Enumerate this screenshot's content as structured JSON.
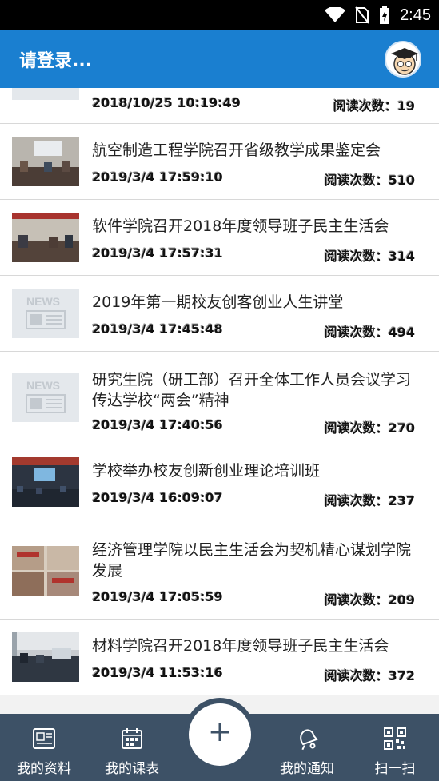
{
  "status": {
    "time": "2:45"
  },
  "appbar": {
    "title": "请登录..."
  },
  "news": [
    {
      "title": "",
      "date": "2018/10/25 10:19:49",
      "reads": "阅读次数：19",
      "thumb": "news"
    },
    {
      "title": "航空制造工程学院召开省级教学成果鉴定会",
      "date": "2019/3/4 17:59:10",
      "reads": "阅读次数：510",
      "thumb": "photo"
    },
    {
      "title": "软件学院召开2018年度领导班子民主生活会",
      "date": "2019/3/4 17:57:31",
      "reads": "阅读次数：314",
      "thumb": "photo"
    },
    {
      "title": "2019年第一期校友创客创业人生讲堂",
      "date": "2019/3/4 17:45:48",
      "reads": "阅读次数：494",
      "thumb": "news"
    },
    {
      "title": "研究生院（研工部）召开全体工作人员会议学习传达学校“两会”精神",
      "date": "2019/3/4 17:40:56",
      "reads": "阅读次数：270",
      "thumb": "news"
    },
    {
      "title": "学校举办校友创新创业理论培训班",
      "date": "2019/3/4 16:09:07",
      "reads": "阅读次数：237",
      "thumb": "photo"
    },
    {
      "title": "经济管理学院以民主生活会为契机精心谋划学院发展",
      "date": "2019/3/4 17:05:59",
      "reads": "阅读次数：209",
      "thumb": "photo"
    },
    {
      "title": "材料学院召开2018年度领导班子民主生活会",
      "date": "2019/3/4 11:53:16",
      "reads": "阅读次数：372",
      "thumb": "photo"
    }
  ],
  "thumb_text": {
    "news_placeholder": "NEWS"
  },
  "bottom": {
    "profile": "我的资料",
    "schedule": "我的课表",
    "add": "+",
    "notice": "我的通知",
    "scan": "扫一扫"
  },
  "colors": {
    "appbar": "#1a7fd0",
    "bottombar": "#3d5166"
  }
}
